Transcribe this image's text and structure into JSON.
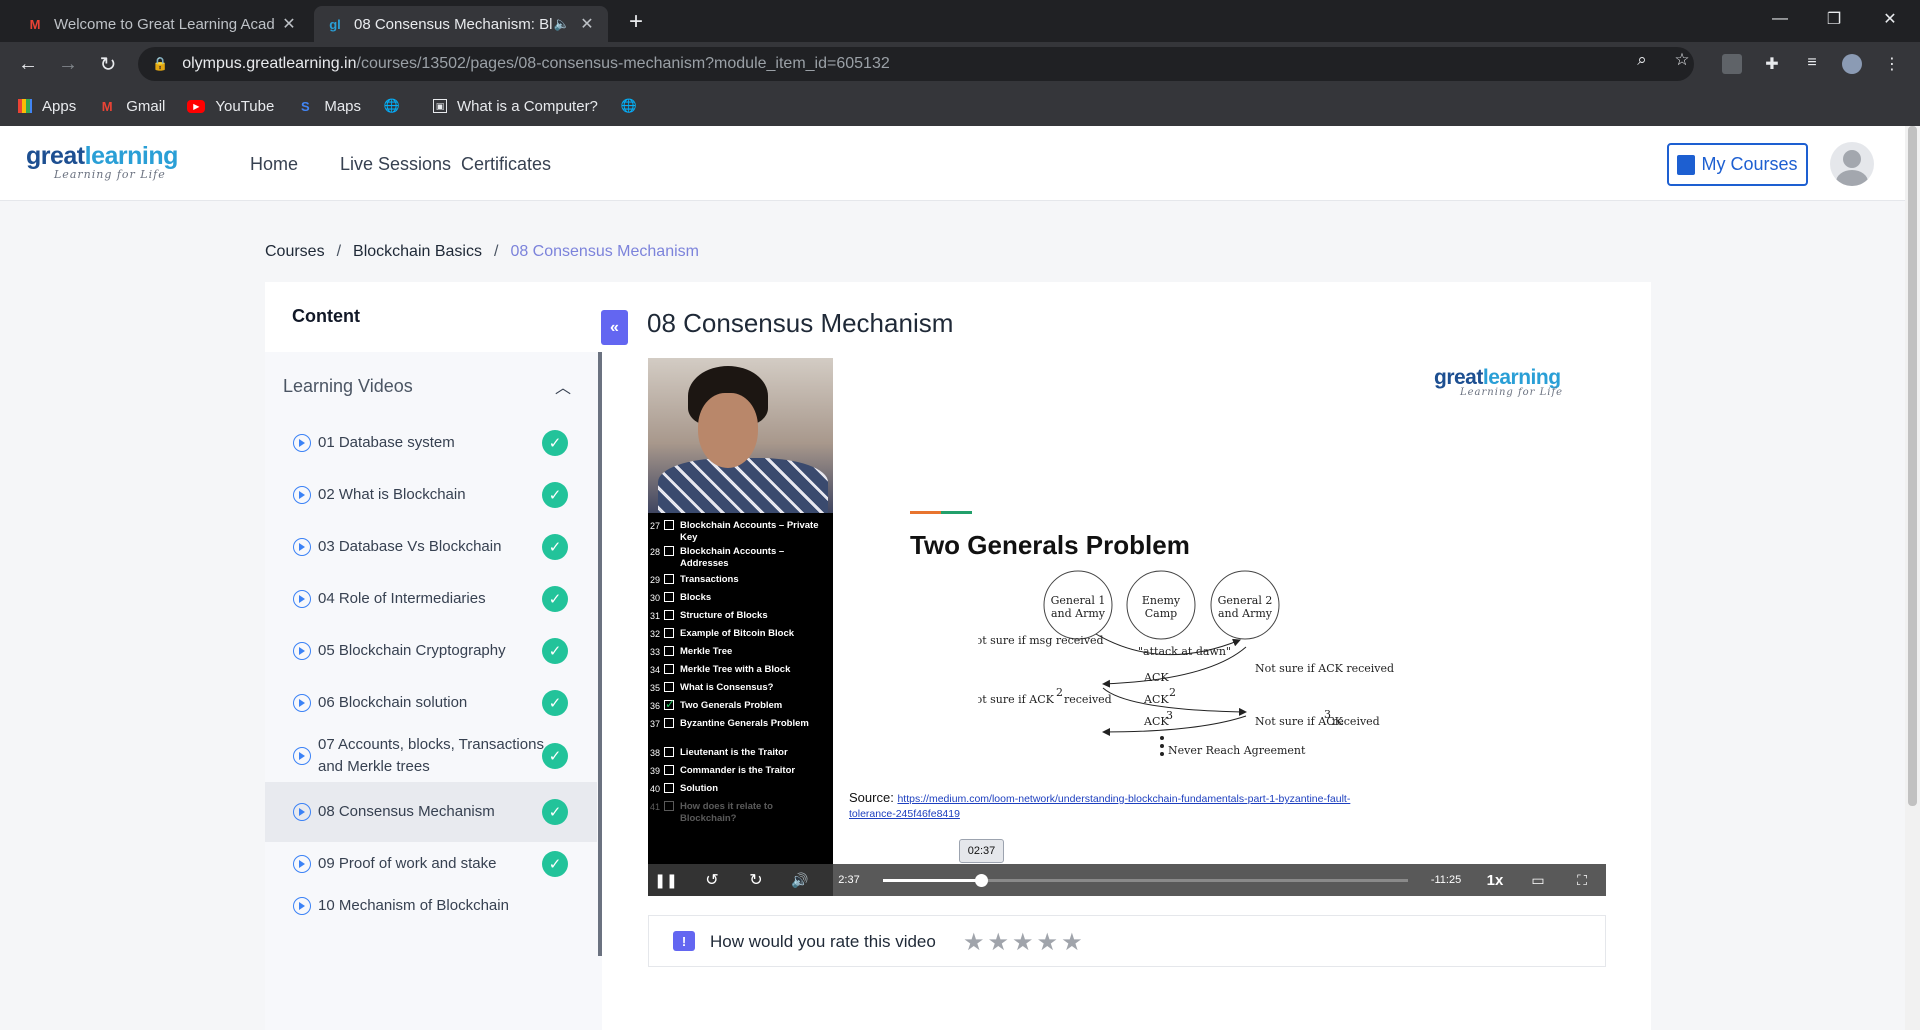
{
  "browser": {
    "tabs": [
      {
        "title": "Welcome to Great Learning Acad",
        "favicon": "gmail-icon",
        "active": false
      },
      {
        "title": "08 Consensus Mechanism: Bl",
        "favicon": "gl-icon",
        "active": true
      }
    ],
    "url_host": "olympus.greatlearning.in",
    "url_path": "/courses/13502/pages/08-consensus-mechanism?module_item_id=605132",
    "bookmarks": [
      "Apps",
      "Gmail",
      "YouTube",
      "Maps",
      "",
      "What is a Computer?",
      ""
    ]
  },
  "site": {
    "logo_main_a": "great",
    "logo_main_b": "learning",
    "logo_tagline": "Learning for Life",
    "nav": [
      "Home",
      "Live Sessions",
      "Certificates"
    ],
    "my_courses": "My Courses"
  },
  "breadcrumb": {
    "items": [
      "Courses",
      "Blockchain Basics",
      "08 Consensus Mechanism"
    ],
    "separator": "/"
  },
  "sidebar": {
    "title": "Content",
    "section": "Learning Videos",
    "items": [
      {
        "label": "01 Database system",
        "completed": true
      },
      {
        "label": "02 What is Blockchain",
        "completed": true
      },
      {
        "label": "03 Database Vs Blockchain",
        "completed": true
      },
      {
        "label": "04 Role of Intermediaries",
        "completed": true
      },
      {
        "label": "05 Blockchain Cryptography",
        "completed": true
      },
      {
        "label": "06 Blockchain solution",
        "completed": true
      },
      {
        "label": "07 Accounts, blocks, Transactions and Merkle trees",
        "completed": true
      },
      {
        "label": "08 Consensus Mechanism",
        "completed": true,
        "current": true
      },
      {
        "label": "09 Proof of work and stake",
        "completed": true
      },
      {
        "label": "10 Mechanism of Blockchain",
        "completed": false
      }
    ]
  },
  "main": {
    "title": "08 Consensus Mechanism"
  },
  "video": {
    "toc": [
      {
        "n": "27",
        "t": "Blockchain Accounts – Private Key"
      },
      {
        "n": "28",
        "t": "Blockchain Accounts – Addresses"
      },
      {
        "n": "29",
        "t": "Transactions"
      },
      {
        "n": "30",
        "t": "Blocks"
      },
      {
        "n": "31",
        "t": "Structure of Blocks"
      },
      {
        "n": "32",
        "t": "Example of Bitcoin Block"
      },
      {
        "n": "33",
        "t": "Merkle Tree"
      },
      {
        "n": "34",
        "t": "Merkle Tree with a Block"
      },
      {
        "n": "35",
        "t": "What is Consensus?"
      },
      {
        "n": "36",
        "t": "Two Generals Problem",
        "checked": true
      },
      {
        "n": "37",
        "t": "Byzantine Generals Problem"
      },
      {
        "n": "38",
        "t": "Lieutenant is the Traitor"
      },
      {
        "n": "39",
        "t": "Commander is the Traitor"
      },
      {
        "n": "40",
        "t": "Solution"
      },
      {
        "n": "41",
        "t": "How does it relate to Blockchain?"
      }
    ],
    "slide_title": "Two Generals Problem",
    "diagram": {
      "general1": [
        "General 1",
        "and Army"
      ],
      "enemy": [
        "Enemy",
        "Camp"
      ],
      "general2": [
        "General 2",
        "and Army"
      ],
      "msg": "\"attack at dawn\"",
      "not_sure_msg": "Not sure if msg received",
      "ack": "ACK",
      "ack2": "ACK",
      "ack3": "ACK",
      "sup2": "2",
      "sup3": "3",
      "not_sure_ack": "Not sure if ACK received",
      "not_sure_ack2_a": "Not sure if ACK",
      "not_sure_ack2_b": "received",
      "not_sure_ack3_a": "Not sure if ACK",
      "not_sure_ack3_b": "received",
      "never": "Never Reach Agreement"
    },
    "source_label": "Source:",
    "source_url": "https://medium.com/loom-network/understanding-blockchain-fundamentals-part-1-byzantine-fault-tolerance-245f46fe8419",
    "tooltip_time": "02:37",
    "current_time": "2:37",
    "remaining_time": "-11:25",
    "speed": "1x",
    "progress_fraction": 0.187
  },
  "rating": {
    "prompt": "How would you rate this video",
    "stars": 5,
    "value": 0
  }
}
